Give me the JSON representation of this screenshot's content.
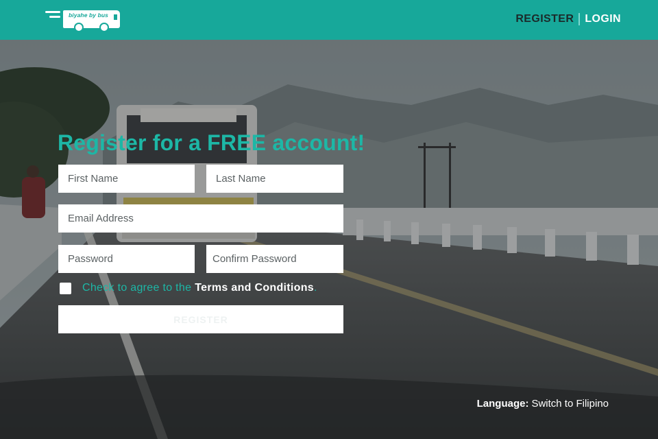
{
  "header": {
    "logo_text": "biyahe by bus",
    "nav": {
      "register": "REGISTER",
      "login": "LOGIN"
    }
  },
  "form": {
    "title": "Register for a FREE account!",
    "first_name_placeholder": "First Name",
    "last_name_placeholder": "Last Name",
    "email_placeholder": "Email Address",
    "password_placeholder": "Password",
    "confirm_password_placeholder": "Confirm Password",
    "agree_text": "Check to agree to the",
    "terms_link": "Terms and Conditions",
    "agree_suffix": ".",
    "submit_label": "REGISTER"
  },
  "footer": {
    "language_label": "Language:",
    "language_link": "Switch to Filipino"
  },
  "colors": {
    "brand": "#17a89a",
    "accent_text": "#1db7a6",
    "nav_dark": "#1b2a2a"
  }
}
